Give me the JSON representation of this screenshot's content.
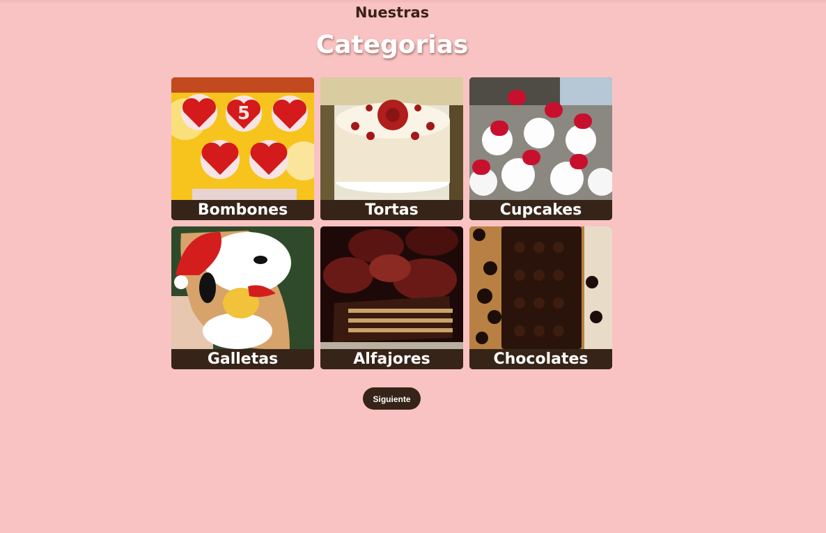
{
  "header": {
    "subtitle": "Nuestras",
    "title": "Categorias"
  },
  "categories": [
    {
      "label": "Bombones",
      "icon": "bombones-photo"
    },
    {
      "label": "Tortas",
      "icon": "tortas-photo"
    },
    {
      "label": "Cupcakes",
      "icon": "cupcakes-photo"
    },
    {
      "label": "Galletas",
      "icon": "galletas-photo"
    },
    {
      "label": "Alfajores",
      "icon": "alfajores-photo"
    },
    {
      "label": "Chocolates",
      "icon": "chocolates-photo"
    }
  ],
  "footer": {
    "next_label": "Siguiente"
  },
  "colors": {
    "background": "#fac3c3",
    "accent_dark": "#372419",
    "text_light": "#ffffff"
  }
}
